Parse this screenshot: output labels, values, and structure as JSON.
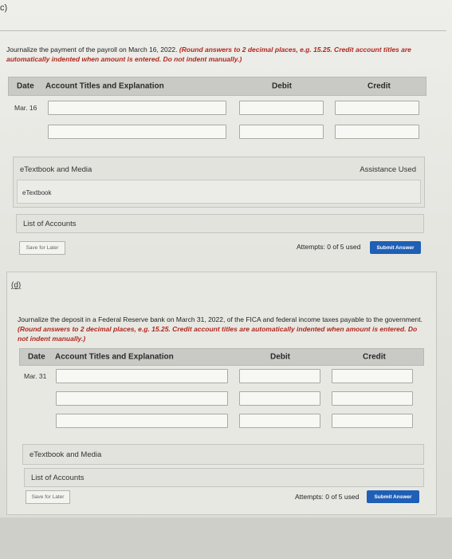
{
  "section_c": {
    "label": "c)",
    "instruction_plain": "Journalize the payment of the payroll on March 16, 2022.",
    "instruction_note": "(Round answers to 2 decimal places, e.g. 15.25. Credit account titles are automatically indented when amount is entered. Do not indent manually.)",
    "table_headers": {
      "date": "Date",
      "account": "Account Titles and Explanation",
      "debit": "Debit",
      "credit": "Credit"
    },
    "row_date": "Mar. 16",
    "etextbook_media": "eTextbook and Media",
    "assistance_used": "Assistance Used",
    "etextbook": "eTextbook",
    "list_of_accounts": "List of Accounts",
    "save_for_later": "Save for Later",
    "attempts": "Attempts: 0 of 5 used",
    "submit_answer": "Submit Answer"
  },
  "section_d": {
    "label": "(d)",
    "instruction_plain": "Journalize the deposit in a Federal Reserve bank on March 31, 2022, of the FICA and federal income taxes payable to the government.",
    "instruction_note": "(Round answers to 2 decimal places, e.g. 15.25. Credit account titles are automatically indented when amount is entered. Do not indent manually.)",
    "table_headers": {
      "date": "Date",
      "account": "Account Titles and Explanation",
      "debit": "Debit",
      "credit": "Credit"
    },
    "row_date": "Mar. 31",
    "etextbook_media": "eTextbook and Media",
    "list_of_accounts": "List of Accounts",
    "save_for_later": "Save for Later",
    "attempts": "Attempts: 0 of 5 used",
    "submit_answer": "Submit Answer"
  },
  "colors": {
    "accent_submit": "#1f5fb5",
    "instruction_red": "#b0281e"
  }
}
